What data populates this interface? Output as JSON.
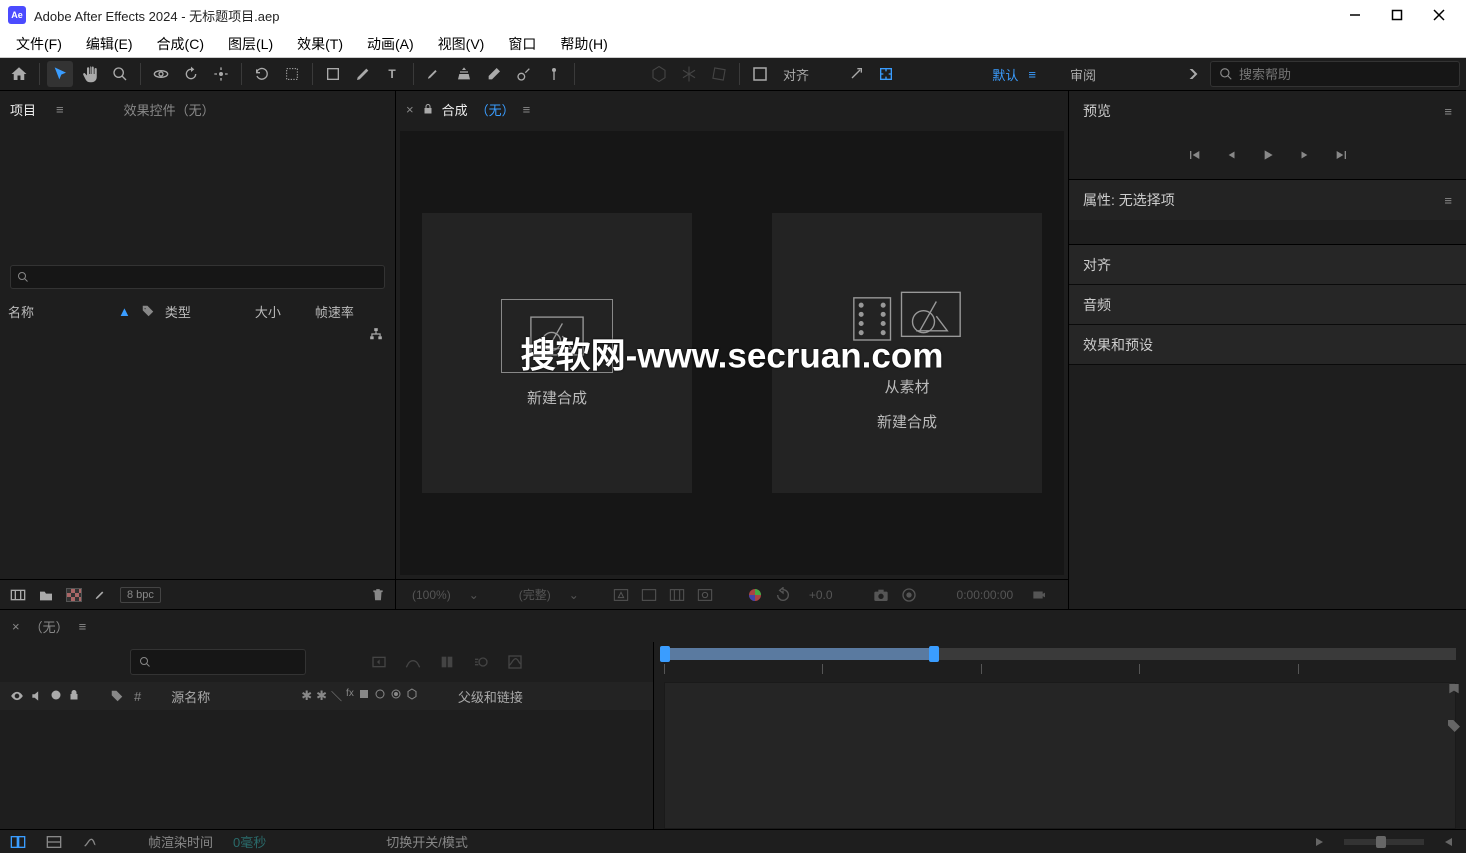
{
  "title": "Adobe After Effects 2024 - 无标题项目.aep",
  "app_icon": "Ae",
  "menubar": [
    "文件(F)",
    "编辑(E)",
    "合成(C)",
    "图层(L)",
    "效果(T)",
    "动画(A)",
    "视图(V)",
    "窗口",
    "帮助(H)"
  ],
  "toolbar": {
    "align_label": "对齐",
    "workspace_default": "默认",
    "workspace_review": "审阅",
    "search_placeholder": "搜索帮助"
  },
  "project": {
    "tab_project": "项目",
    "tab_fx": "效果控件（无）",
    "col_name": "名称",
    "col_type": "类型",
    "col_size": "大小",
    "col_fps": "帧速率",
    "bpc": "8 bpc"
  },
  "comp": {
    "tab_label": "合成",
    "tab_none": "（无）",
    "card_new": "新建合成",
    "card_from_footage_line1": "从素材",
    "card_from_footage_line2": "新建合成",
    "zoom": "(100%)",
    "full": "(完整)",
    "exposure": "+0.0",
    "timecode": "0:00:00:00"
  },
  "right": {
    "preview": "预览",
    "properties": "属性: 无选择项",
    "align": "对齐",
    "audio": "音频",
    "effects_presets": "效果和预设"
  },
  "timeline": {
    "tab_none": "（无）",
    "col_source": "源名称",
    "col_parent": "父级和链接",
    "frame_render": "帧渲染时间",
    "frame_render_zero": "0毫秒",
    "toggle_switches": "切换开关/模式"
  },
  "watermark": "搜软网-www.secruan.com"
}
